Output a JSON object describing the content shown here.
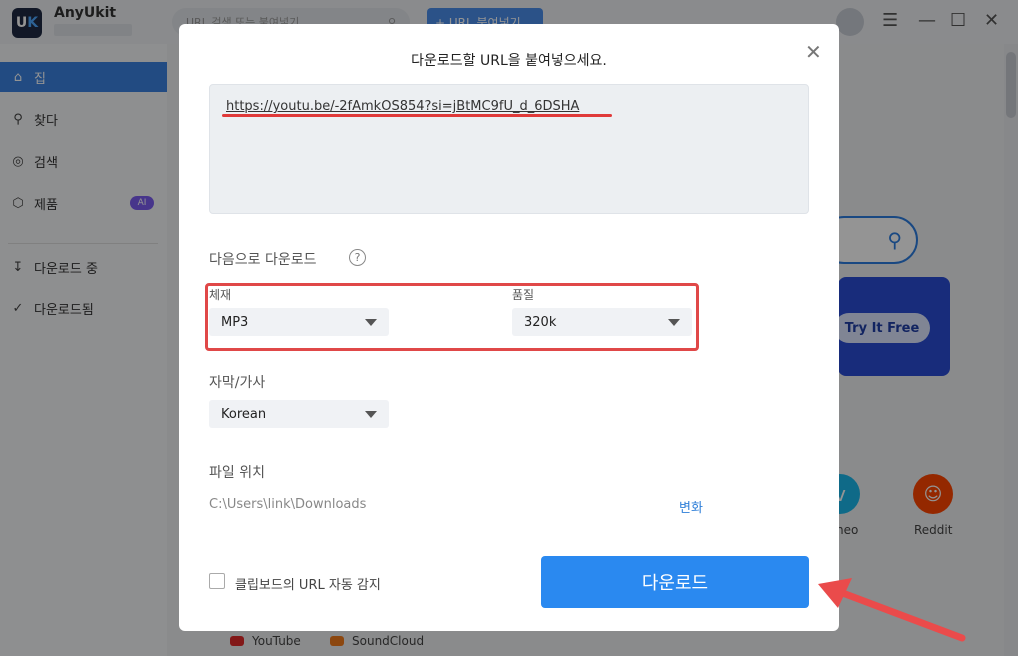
{
  "app": {
    "name": "AnyUkit",
    "logo_text": "U",
    "logo_k": "K",
    "search_placeholder": "URL 검색 또는 붙여넣기",
    "paste_button": "+ URL 붙여넣기"
  },
  "sidebar": {
    "items": [
      {
        "label": "집",
        "icon": "home-icon"
      },
      {
        "label": "찾다",
        "icon": "search-icon"
      },
      {
        "label": "검색",
        "icon": "compass-icon"
      },
      {
        "label": "제품",
        "icon": "cube-icon",
        "badge": "AI"
      },
      {
        "label": "다운로드 중",
        "icon": "download-icon"
      },
      {
        "label": "다운로드됨",
        "icon": "check-circle-icon"
      }
    ]
  },
  "background": {
    "try_button": "Try It Free",
    "vimeo_label": "neo",
    "reddit_label": "Reddit",
    "footer": [
      "YouTube",
      "SoundCloud"
    ]
  },
  "dialog": {
    "title": "다운로드할 URL을 붙여넣으세요.",
    "url": "https://youtu.be/-2fAmkOS854?si=jBtMC9fU_d_6DSHA",
    "download_as_label": "다음으로 다운로드",
    "format_label": "체재",
    "format_value": "MP3",
    "quality_label": "품질",
    "quality_value": "320k",
    "subtitle_label": "자막/가사",
    "subtitle_value": "Korean",
    "location_label": "파일 위치",
    "location_path": "C:\\Users\\link\\Downloads",
    "change_link": "변화",
    "clipboard_label": "클립보드의 URL 자동 감지",
    "download_button": "다운로드"
  },
  "colors": {
    "accent": "#2a89f0",
    "highlight": "#e04848"
  }
}
